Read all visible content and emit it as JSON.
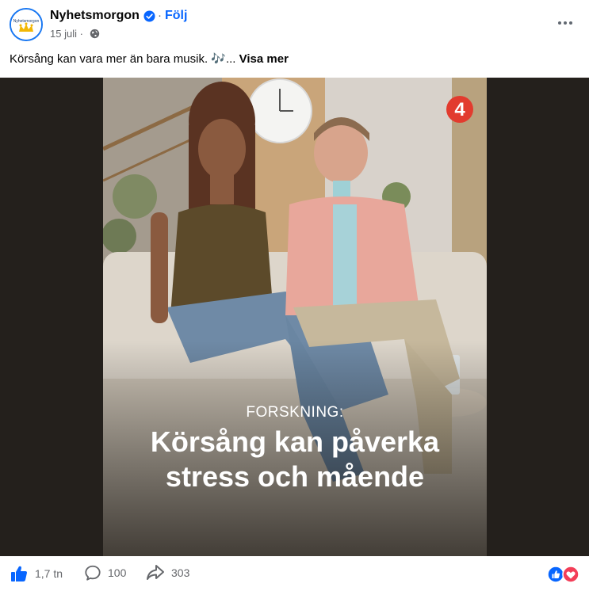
{
  "post": {
    "page_name": "Nyhetsmorgon",
    "follow_label": "Följ",
    "separator": "·",
    "date": "15 juli ·",
    "text": "Körsång kan vara mer än bara musik. 🎶...",
    "see_more_label": "Visa mer",
    "avatar_wordmark": "Nyhetsmorgon"
  },
  "media": {
    "kicker": "FORSKNING:",
    "title_line1": "Körsång kan påverka",
    "title_line2": "stress och mående",
    "channel_logo": "4"
  },
  "footer": {
    "likes": "1,7 tn",
    "comments": "100",
    "shares": "303"
  },
  "icons": {
    "verified": "verified-badge-icon",
    "globe": "globe-icon",
    "more": "more-options-icon",
    "like": "like-icon",
    "comment": "comment-icon",
    "share": "share-icon",
    "reactions": "reactions-icon"
  },
  "colors": {
    "facebook_blue": "#0866ff",
    "secondary_text": "#65676b",
    "media_background": "#24201c",
    "love_red": "#f33e58"
  }
}
